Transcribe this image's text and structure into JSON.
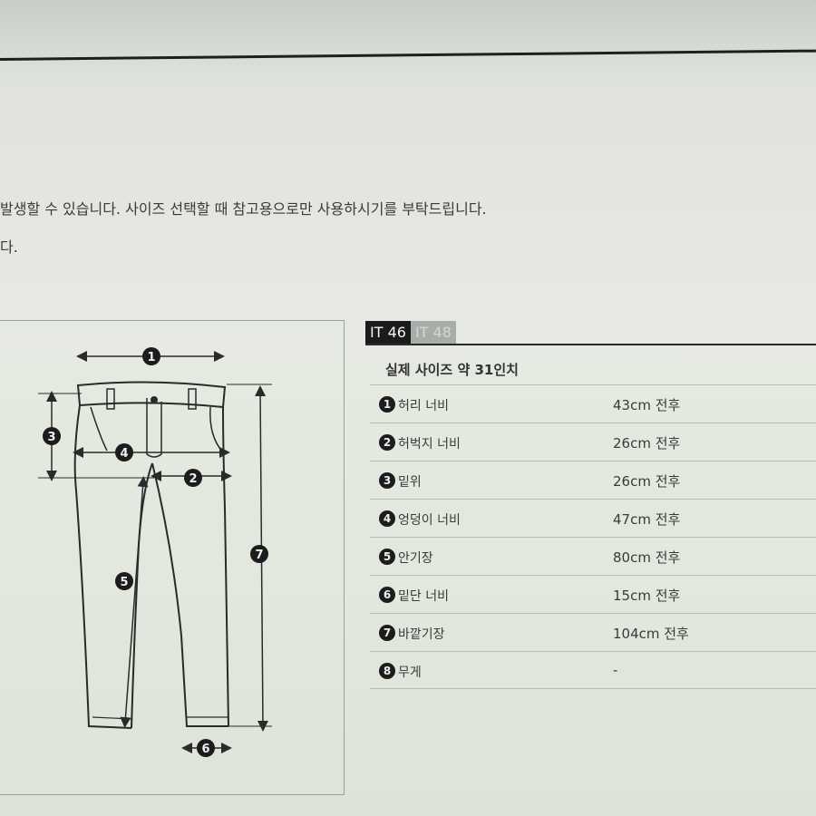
{
  "notice": {
    "line1": "발생할 수 있습니다. 사이즈 선택할 때 참고용으로만 사용하시기를 부탁드립니다.",
    "line2": "다."
  },
  "diagram": {
    "markers": [
      "1",
      "2",
      "3",
      "4",
      "5",
      "6",
      "7"
    ]
  },
  "tabs": [
    {
      "label": "IT 46",
      "active": true
    },
    {
      "label": "IT 48",
      "active": false
    }
  ],
  "size_title": "실제 사이즈 약 31인치",
  "specs": [
    {
      "num": "1",
      "label": "허리 너비",
      "value": "43cm 전후"
    },
    {
      "num": "2",
      "label": "허벅지 너비",
      "value": "26cm 전후"
    },
    {
      "num": "3",
      "label": "밑위",
      "value": "26cm 전후"
    },
    {
      "num": "4",
      "label": "엉덩이 너비",
      "value": "47cm 전후"
    },
    {
      "num": "5",
      "label": "안기장",
      "value": "80cm 전후"
    },
    {
      "num": "6",
      "label": "밑단 너비",
      "value": "15cm 전후"
    },
    {
      "num": "7",
      "label": "바깥기장",
      "value": "104cm 전후"
    },
    {
      "num": "8",
      "label": "무게",
      "value": "-"
    }
  ],
  "colors": {
    "active_tab": "#1b1b1b",
    "inactive_tab": "#a9ada9",
    "badge": "#1c1c1c"
  }
}
